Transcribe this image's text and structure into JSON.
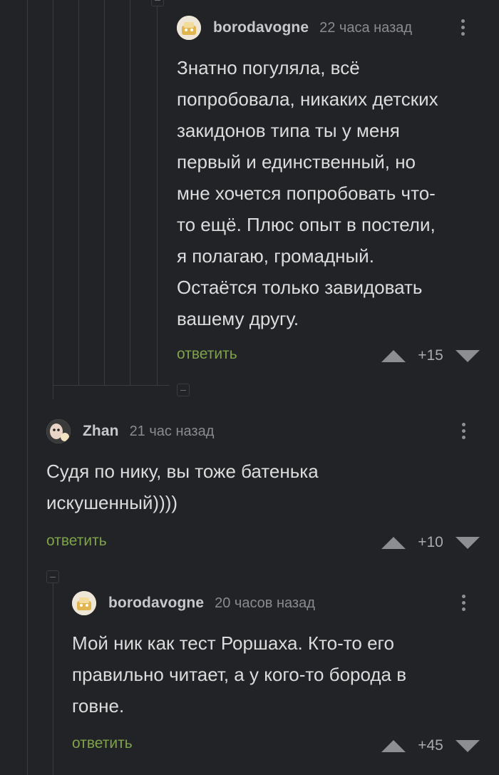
{
  "comments": [
    {
      "author": "borodavogne",
      "time": "22 часа назад",
      "lines": [
        "Знатно погуляла, всё",
        "попробовала, никаких детских",
        "закидонов типа ты у меня",
        "первый и единственный, но",
        "мне хочется попробовать что-",
        "то ещё. Плюс опыт в постели,",
        "я полагаю, громадный.",
        "Остаётся только завидовать",
        "вашему другу."
      ],
      "reply_label": "ответить",
      "score": "+15"
    },
    {
      "author": "Zhan",
      "time": "21 час назад",
      "lines": [
        "Судя по нику, вы тоже батенька",
        "искушенный))))"
      ],
      "reply_label": "ответить",
      "score": "+10"
    },
    {
      "author": "borodavogne",
      "time": "20 часов назад",
      "lines": [
        "Мой ник как тест Роршаха. Кто-то его",
        "правильно читает, а у кого-то борода в",
        "говне."
      ],
      "reply_label": "ответить",
      "score": "+45"
    }
  ],
  "icons": {
    "collapse": "minus-square-icon",
    "menu": "kebab-menu-icon",
    "upvote": "arrow-up-icon",
    "downvote": "arrow-down-icon"
  },
  "colors": {
    "background": "#222326",
    "reply": "#7ea34a",
    "thread_line": "#3a3b3f"
  }
}
